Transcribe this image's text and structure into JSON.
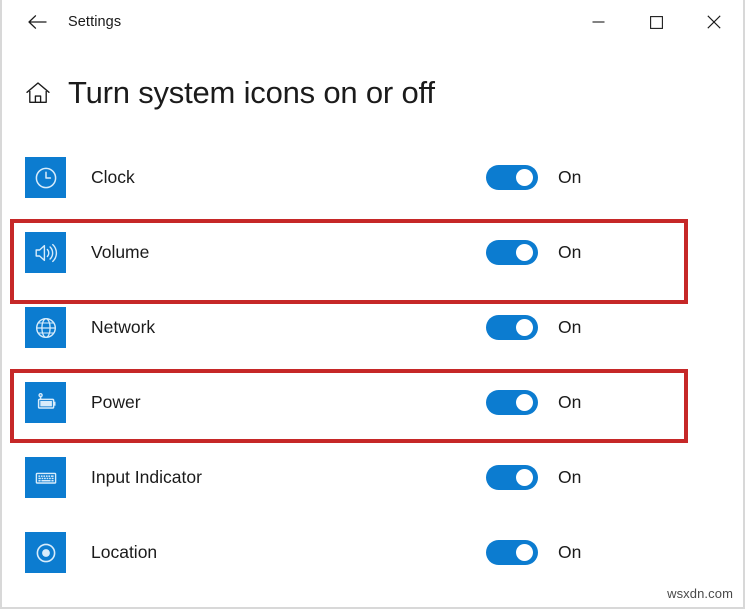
{
  "window": {
    "app_title": "Settings",
    "back_icon": "back-arrow-icon",
    "minimize_label": "Minimize",
    "maximize_label": "Maximize",
    "close_label": "Close"
  },
  "page": {
    "home_icon": "home-icon",
    "title": "Turn system icons on or off"
  },
  "rows": [
    {
      "label": "Clock",
      "icon": "clock-icon",
      "state": "On",
      "highlighted": false
    },
    {
      "label": "Volume",
      "icon": "volume-icon",
      "state": "On",
      "highlighted": true
    },
    {
      "label": "Network",
      "icon": "network-globe-icon",
      "state": "On",
      "highlighted": false
    },
    {
      "label": "Power",
      "icon": "power-battery-icon",
      "state": "On",
      "highlighted": true
    },
    {
      "label": "Input Indicator",
      "icon": "keyboard-icon",
      "state": "On",
      "highlighted": false
    },
    {
      "label": "Location",
      "icon": "location-target-icon",
      "state": "On",
      "highlighted": false
    }
  ],
  "annotations": [
    {
      "target": "Volume",
      "color": "#c62828"
    },
    {
      "target": "Power",
      "color": "#c62828"
    }
  ],
  "colors": {
    "accent_blue": "#0c7cd0",
    "annotation_red": "#c62828",
    "text": "#1b1b1b",
    "background": "#ffffff"
  },
  "watermark": {
    "text": "wsxdn.com"
  }
}
